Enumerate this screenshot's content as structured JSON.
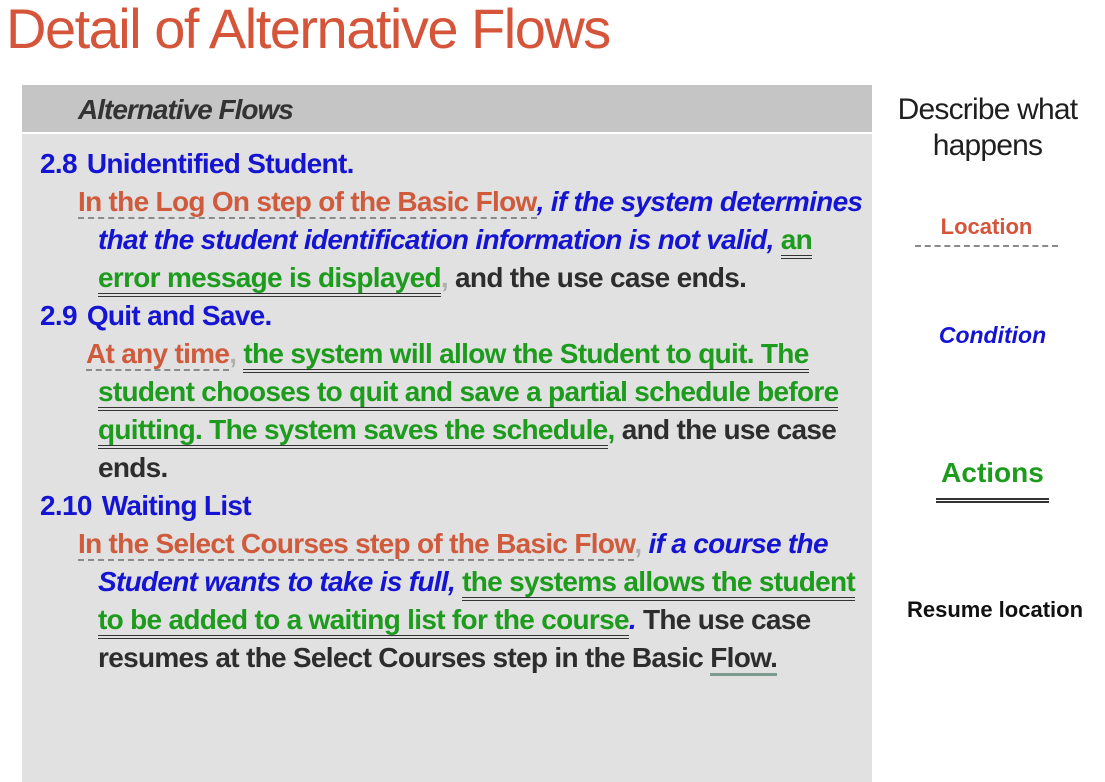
{
  "title": "Detail of Alternative Flows",
  "panel": {
    "header": "Alternative Flows",
    "flows": [
      {
        "number": "2.8",
        "name": "Unidentified Student.",
        "location": "In the Log On step of the Basic Flow",
        "sep1": ", ",
        "condition": "if the system determines that the student identification information is not valid",
        "sep2": ", ",
        "action": "an error message is displayed",
        "sep3": ",",
        "resume": " and the use case ends."
      },
      {
        "number": "2.9",
        "name": "Quit and Save.",
        "location": "At any time",
        "sep1": ", ",
        "action": "the system will allow the Student to quit.  The student chooses to quit and save a partial schedule before quitting. The system saves the schedule",
        "sep2": ",",
        "resume": " and the use case ends."
      },
      {
        "number": "2.10",
        "name": "Waiting List",
        "location": "In the Select Courses step of the Basic Flow",
        "sep1": ", ",
        "condition": "if a course the Student wants to take is full",
        "sep2": ", ",
        "action": "the systems allows the student to be added to a waiting list for the course",
        "sep3": ".",
        "resume_text": "  The use case resumes at the Select Courses step in the Basic ",
        "resume_end": "Flow."
      }
    ]
  },
  "legend": {
    "describe": "Describe what happens",
    "location": "Location",
    "condition": "Condition",
    "actions": "Actions",
    "resume": "Resume location"
  },
  "colors": {
    "title": "#d4553a",
    "location": "#cf5a3c",
    "condition": "#1414d2",
    "action": "#1d9b1d",
    "panel": "#e1e1e1"
  }
}
